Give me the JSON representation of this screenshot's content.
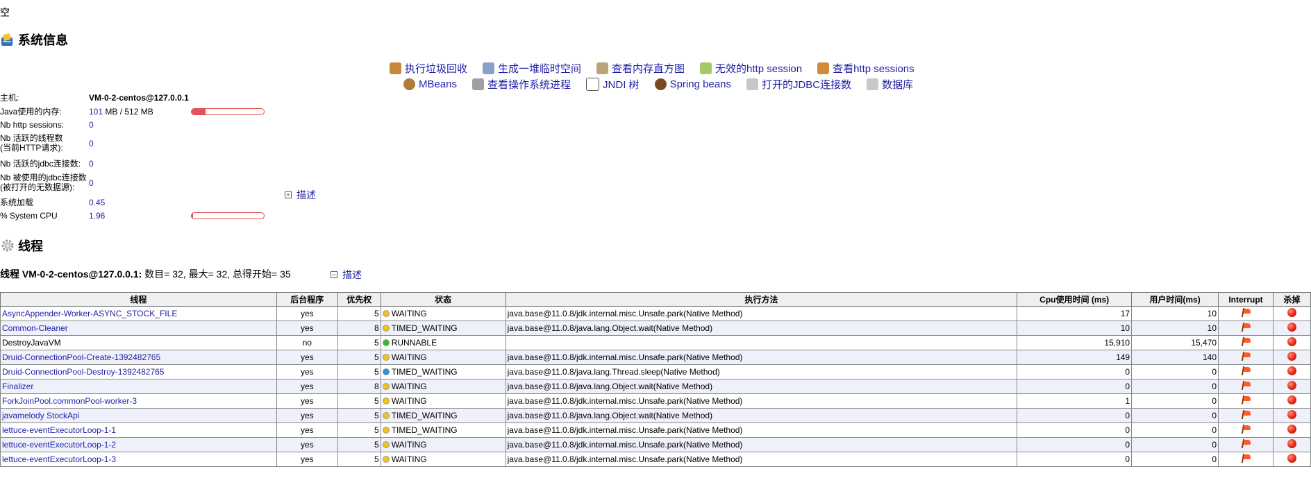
{
  "top_char": "空",
  "system_info": {
    "title": "系统信息",
    "actions_row1": [
      {
        "label": "执行垃圾回收",
        "icon": "broom-icon"
      },
      {
        "label": "生成一堆临时空间",
        "icon": "heap-dump-icon"
      },
      {
        "label": "查看内存直方图",
        "icon": "memory-histogram-icon"
      },
      {
        "label": "无效的http session",
        "icon": "invalid-session-icon"
      },
      {
        "label": "查看http sessions",
        "icon": "users-icon"
      }
    ],
    "actions_row2": [
      {
        "label": "MBeans",
        "icon": "beans-icon"
      },
      {
        "label": "查看操作系统进程",
        "icon": "processes-icon"
      },
      {
        "label": "JNDI 树",
        "icon": "jndi-tree-icon"
      },
      {
        "label": "Spring beans",
        "icon": "spring-bean-icon"
      },
      {
        "label": "打开的JDBC连接数",
        "icon": "database-icon"
      },
      {
        "label": "数据库",
        "icon": "database-icon"
      }
    ],
    "rows": {
      "host_label": "主机:",
      "host_value": "VM-0-2-centos@127.0.0.1",
      "mem_label": "Java使用的内存:",
      "mem_used": "101",
      "mem_rest": " MB / 512 MB",
      "mem_fraction": 0.197,
      "http_label": "Nb http sessions:",
      "http_value": "0",
      "threads_label": "Nb 活跃的线程数\n(当前HTTP请求):",
      "threads_value": "0",
      "jdbc_active_label": "Nb 活跃的jdbc连接数:",
      "jdbc_active_value": "0",
      "jdbc_used_label": "Nb 被使用的jdbc连接数\n(被打开的无数据源):",
      "jdbc_used_value": "0",
      "load_label": "系统加载",
      "load_value": "0.45",
      "cpu_label": "% System CPU",
      "cpu_value": "1.96",
      "cpu_fraction": 0.0196
    },
    "describe_label": "描述"
  },
  "threads": {
    "title": "线程",
    "host_label": "线程 VM-0-2-centos@127.0.0.1:",
    "summary": " 数目= 32, 最大= 32, 总得开始= 35",
    "describe_label": "描述",
    "columns": [
      "线程",
      "后台程序",
      "优先权",
      "状态",
      "执行方法",
      "Cpu使用时间 (ms)",
      "用户时间(ms)",
      "Interrupt",
      "杀掉"
    ],
    "rows": [
      {
        "name": "AsyncAppender-Worker-ASYNC_STOCK_FILE",
        "daemon": "yes",
        "priority": "5",
        "state": "WAITING",
        "state_color": "#f0c419",
        "method": "java.base@11.0.8/jdk.internal.misc.Unsafe.park(Native Method)",
        "cpu": "17",
        "user": "10"
      },
      {
        "name": "Common-Cleaner",
        "daemon": "yes",
        "priority": "8",
        "state": "TIMED_WAITING",
        "state_color": "#f0c419",
        "method": "java.base@11.0.8/java.lang.Object.wait(Native Method)",
        "cpu": "10",
        "user": "10"
      },
      {
        "name": "DestroyJavaVM",
        "daemon": "no",
        "priority": "5",
        "state": "RUNNABLE",
        "state_color": "#3cb82e",
        "method": "",
        "cpu": "15,910",
        "user": "15,470"
      },
      {
        "name": "Druid-ConnectionPool-Create-1392482765",
        "daemon": "yes",
        "priority": "5",
        "state": "WAITING",
        "state_color": "#f0c419",
        "method": "java.base@11.0.8/jdk.internal.misc.Unsafe.park(Native Method)",
        "cpu": "149",
        "user": "140"
      },
      {
        "name": "Druid-ConnectionPool-Destroy-1392482765",
        "daemon": "yes",
        "priority": "5",
        "state": "TIMED_WAITING",
        "state_color": "#2f8fe0",
        "method": "java.base@11.0.8/java.lang.Thread.sleep(Native Method)",
        "cpu": "0",
        "user": "0"
      },
      {
        "name": "Finalizer",
        "daemon": "yes",
        "priority": "8",
        "state": "WAITING",
        "state_color": "#f0c419",
        "method": "java.base@11.0.8/java.lang.Object.wait(Native Method)",
        "cpu": "0",
        "user": "0"
      },
      {
        "name": "ForkJoinPool.commonPool-worker-3",
        "daemon": "yes",
        "priority": "5",
        "state": "WAITING",
        "state_color": "#f0c419",
        "method": "java.base@11.0.8/jdk.internal.misc.Unsafe.park(Native Method)",
        "cpu": "1",
        "user": "0"
      },
      {
        "name": "javamelody StockApi",
        "daemon": "yes",
        "priority": "5",
        "state": "TIMED_WAITING",
        "state_color": "#f0c419",
        "method": "java.base@11.0.8/java.lang.Object.wait(Native Method)",
        "cpu": "0",
        "user": "0"
      },
      {
        "name": "lettuce-eventExecutorLoop-1-1",
        "daemon": "yes",
        "priority": "5",
        "state": "TIMED_WAITING",
        "state_color": "#f0c419",
        "method": "java.base@11.0.8/jdk.internal.misc.Unsafe.park(Native Method)",
        "cpu": "0",
        "user": "0"
      },
      {
        "name": "lettuce-eventExecutorLoop-1-2",
        "daemon": "yes",
        "priority": "5",
        "state": "WAITING",
        "state_color": "#f0c419",
        "method": "java.base@11.0.8/jdk.internal.misc.Unsafe.park(Native Method)",
        "cpu": "0",
        "user": "0"
      },
      {
        "name": "lettuce-eventExecutorLoop-1-3",
        "daemon": "yes",
        "priority": "5",
        "state": "WAITING",
        "state_color": "#f0c419",
        "method": "java.base@11.0.8/jdk.internal.misc.Unsafe.park(Native Method)",
        "cpu": "0",
        "user": "0"
      }
    ]
  }
}
